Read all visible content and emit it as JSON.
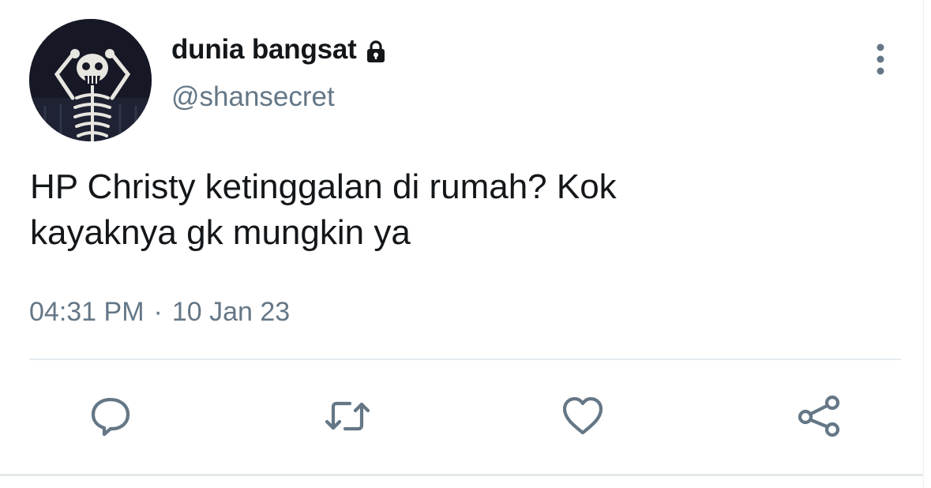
{
  "tweet": {
    "author": {
      "display_name": "dunia bangsat",
      "handle": "@shansecret",
      "protected": true
    },
    "text_line1": "HP Christy ketinggalan di rumah? Kok",
    "text_line2": "kayaknya gk mungkin ya",
    "time": "04:31 PM",
    "separator": "·",
    "date": "10 Jan 23"
  },
  "icons": {
    "lock": "lock-icon",
    "more": "more-vertical-icon",
    "reply": "reply-icon",
    "retweet": "retweet-icon",
    "like": "heart-icon",
    "share": "share-icon"
  },
  "colors": {
    "text": "#14171a",
    "secondary": "#657786",
    "icon": "#657786",
    "divider": "#e6ecf0"
  }
}
